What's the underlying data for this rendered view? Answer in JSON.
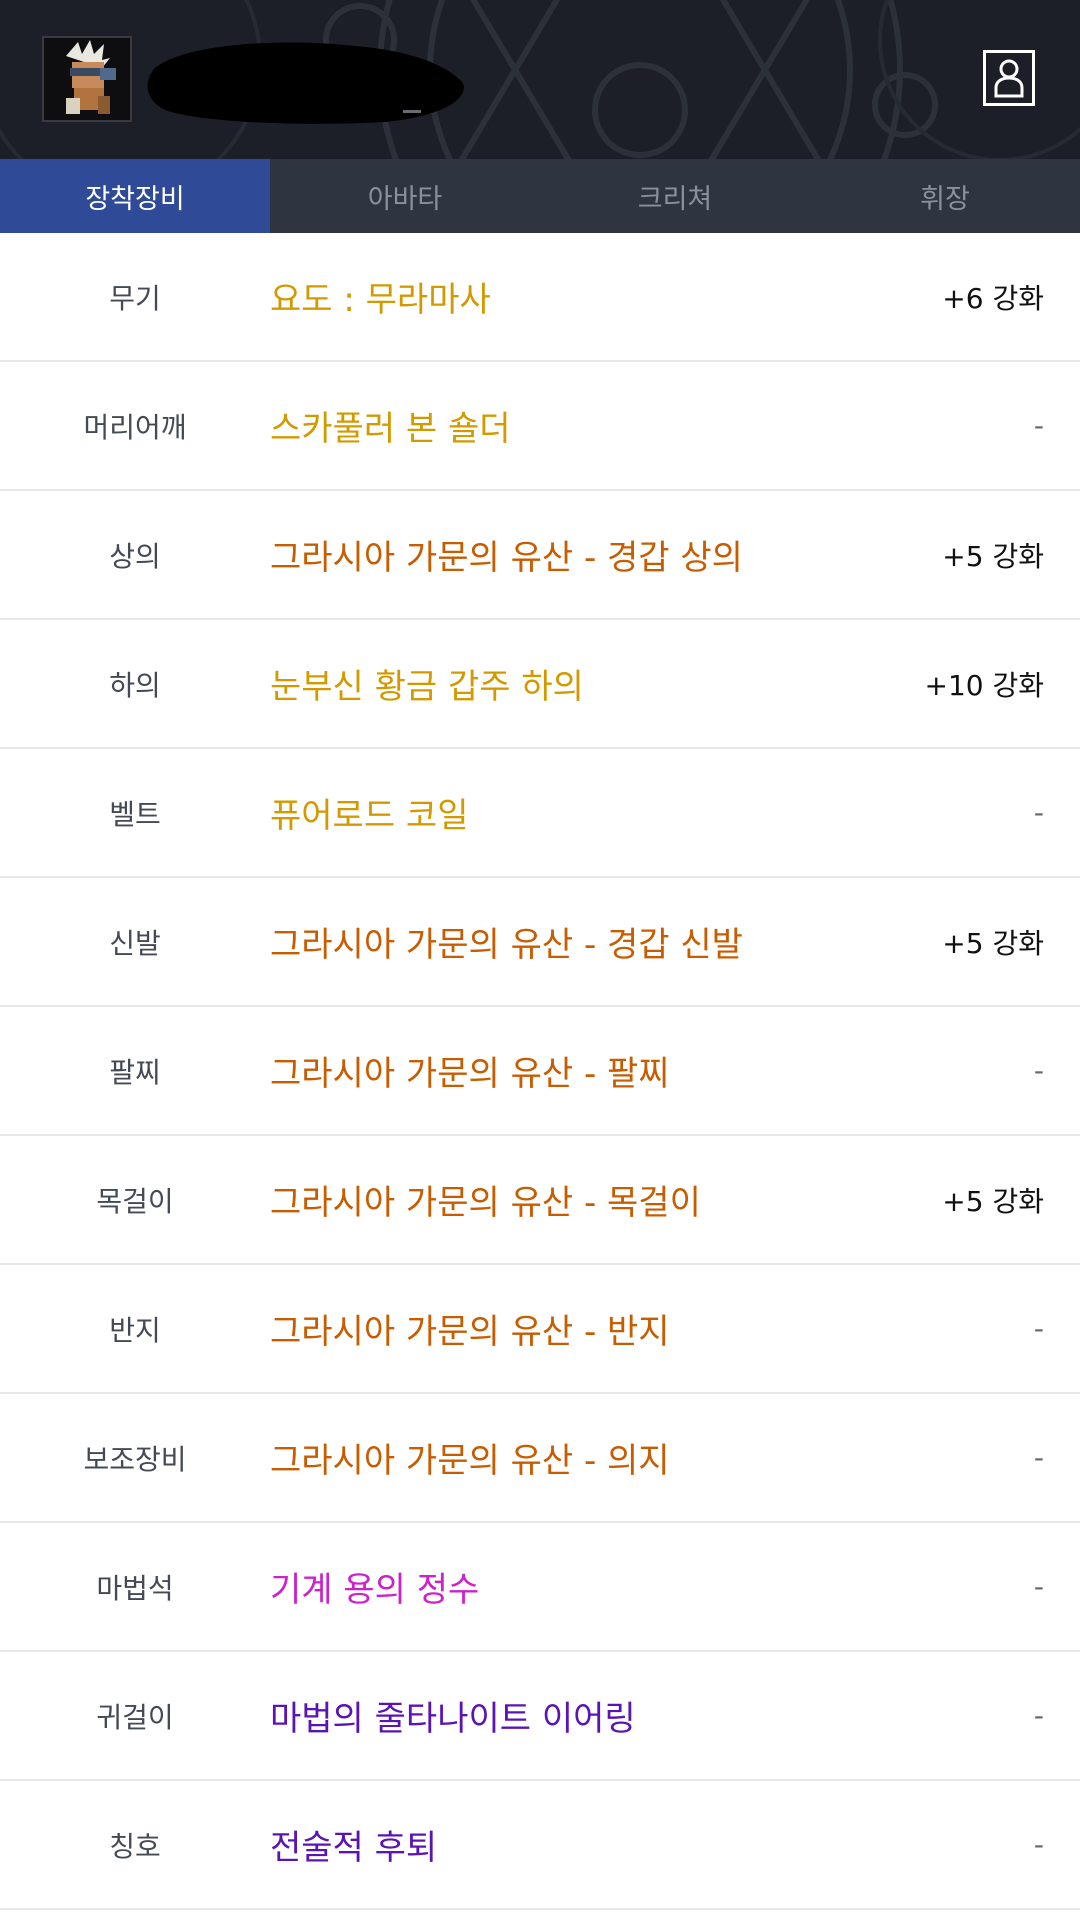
{
  "header": {
    "avatar_icon": "character-avatar-icon",
    "profile_icon": "profile-icon"
  },
  "tabs": [
    {
      "label": "장착장비",
      "active": true
    },
    {
      "label": "아바타",
      "active": false
    },
    {
      "label": "크리쳐",
      "active": false
    },
    {
      "label": "휘장",
      "active": false
    }
  ],
  "colors": {
    "unique": "#d39a00",
    "epic": "#c85c00",
    "legendary": "#cc22cc",
    "rare": "#5a14b4",
    "tab_active_bg": "#2f4b97",
    "tab_bar_bg": "#2e3440",
    "header_bg": "#1c1f27"
  },
  "equipment": [
    {
      "slot": "무기",
      "item": "요도 : 무라마사",
      "enhance": "+6 강화",
      "color": "#d39a00"
    },
    {
      "slot": "머리어깨",
      "item": "스카풀러 본 숄더",
      "enhance": "-",
      "color": "#d39a00"
    },
    {
      "slot": "상의",
      "item": "그라시아 가문의 유산 - 경갑 상의",
      "enhance": "+5 강화",
      "color": "#c85c00"
    },
    {
      "slot": "하의",
      "item": "눈부신 황금 갑주 하의",
      "enhance": "+10 강화",
      "color": "#d39a00"
    },
    {
      "slot": "벨트",
      "item": "퓨어로드 코일",
      "enhance": "-",
      "color": "#d39a00"
    },
    {
      "slot": "신발",
      "item": "그라시아 가문의 유산 - 경갑 신발",
      "enhance": "+5 강화",
      "color": "#c85c00"
    },
    {
      "slot": "팔찌",
      "item": "그라시아 가문의 유산 - 팔찌",
      "enhance": "-",
      "color": "#c85c00"
    },
    {
      "slot": "목걸이",
      "item": "그라시아 가문의 유산 - 목걸이",
      "enhance": "+5 강화",
      "color": "#c85c00"
    },
    {
      "slot": "반지",
      "item": "그라시아 가문의 유산 - 반지",
      "enhance": "-",
      "color": "#c85c00"
    },
    {
      "slot": "보조장비",
      "item": "그라시아 가문의 유산 - 의지",
      "enhance": "-",
      "color": "#c85c00"
    },
    {
      "slot": "마법석",
      "item": "기계 용의 정수",
      "enhance": "-",
      "color": "#cc22cc"
    },
    {
      "slot": "귀걸이",
      "item": "마법의 줄타나이트 이어링",
      "enhance": "-",
      "color": "#5a14b4"
    },
    {
      "slot": "칭호",
      "item": "전술적 후퇴",
      "enhance": "-",
      "color": "#5a14b4"
    }
  ]
}
